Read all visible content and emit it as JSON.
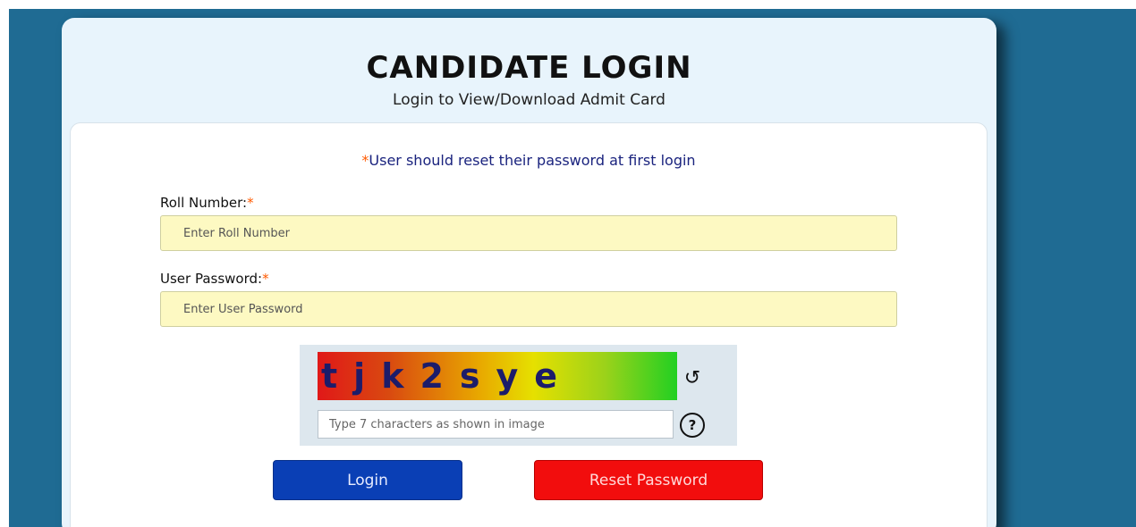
{
  "colors": {
    "page_background": "#1f6b93",
    "card_background": "#e8f4fc",
    "field_background": "#fdf9c2",
    "required_star": "#ff5a00",
    "login_button": "#0a3fb5",
    "reset_button": "#f20d0d"
  },
  "header": {
    "title": "CANDIDATE LOGIN",
    "subtitle": "Login to View/Download Admit Card"
  },
  "form": {
    "notice_star": "*",
    "notice": "User should reset their password at first login",
    "roll_number": {
      "label": "Roll Number:",
      "required_mark": "*",
      "placeholder": "Enter Roll Number"
    },
    "password": {
      "label": "User Password:",
      "required_mark": "*",
      "placeholder": "Enter User Password"
    },
    "captcha": {
      "text": "tjk2sye",
      "refresh_icon": "refresh-icon",
      "placeholder": "Type 7 characters as shown in image",
      "help_icon": "help-icon",
      "help_glyph": "?"
    },
    "buttons": {
      "login": "Login",
      "reset": "Reset Password"
    }
  }
}
